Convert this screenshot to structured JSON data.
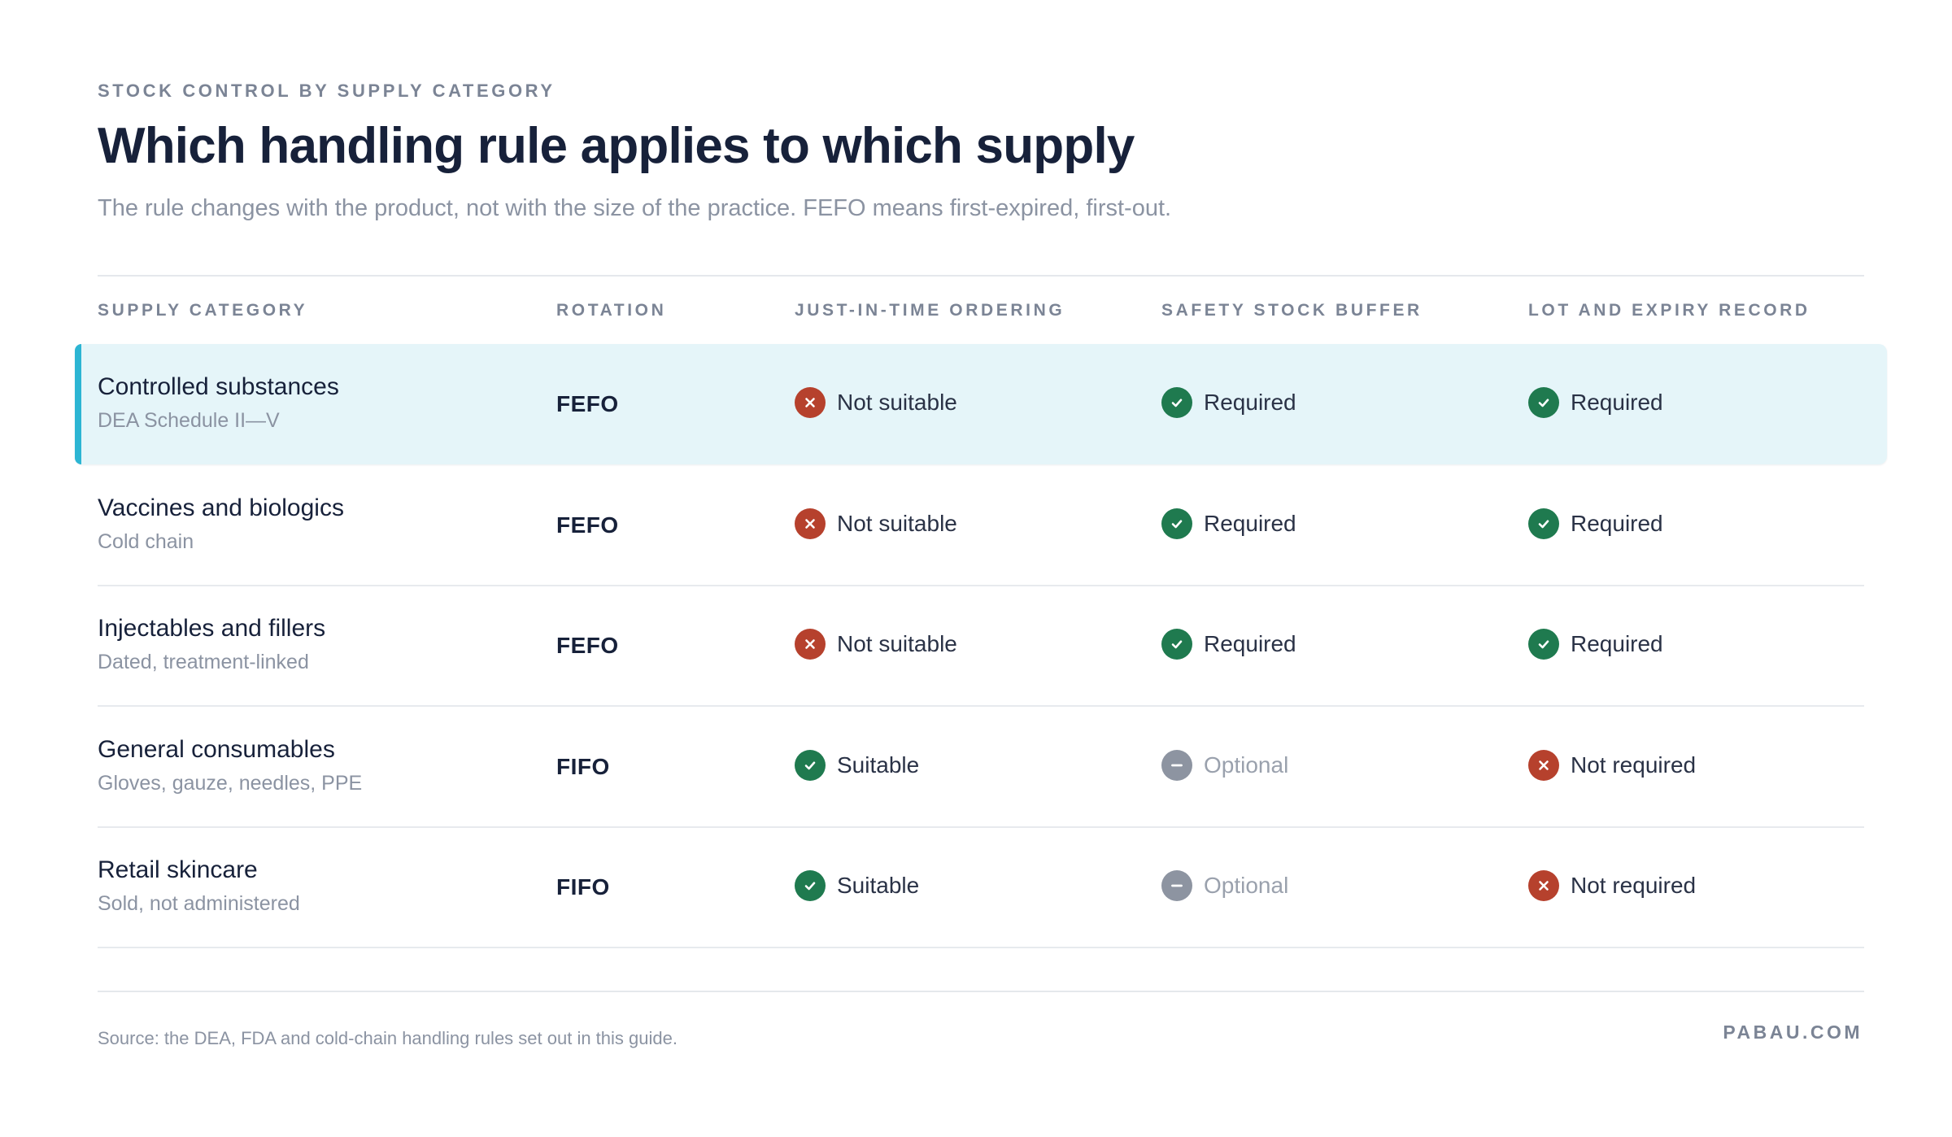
{
  "header": {
    "eyebrow": "STOCK CONTROL BY SUPPLY CATEGORY",
    "title": "Which handling rule applies to which supply",
    "subtitle": "The rule changes with the product, not with the size of the practice. FEFO means first-expired, first-out."
  },
  "table": {
    "columns": [
      "SUPPLY CATEGORY",
      "ROTATION",
      "JUST-IN-TIME ORDERING",
      "SAFETY STOCK BUFFER",
      "LOT AND EXPIRY RECORD"
    ],
    "highlighted_row": 0,
    "rows": [
      {
        "name": "Controlled substances",
        "detail": "DEA Schedule II—V",
        "rotation": "FEFO",
        "jit": {
          "status": "no",
          "label": "Not suitable"
        },
        "safety": {
          "status": "ok",
          "label": "Required"
        },
        "lot": {
          "status": "ok",
          "label": "Required"
        }
      },
      {
        "name": "Vaccines and biologics",
        "detail": "Cold chain",
        "rotation": "FEFO",
        "jit": {
          "status": "no",
          "label": "Not suitable"
        },
        "safety": {
          "status": "ok",
          "label": "Required"
        },
        "lot": {
          "status": "ok",
          "label": "Required"
        }
      },
      {
        "name": "Injectables and fillers",
        "detail": "Dated, treatment-linked",
        "rotation": "FEFO",
        "jit": {
          "status": "no",
          "label": "Not suitable"
        },
        "safety": {
          "status": "ok",
          "label": "Required"
        },
        "lot": {
          "status": "ok",
          "label": "Required"
        }
      },
      {
        "name": "General consumables",
        "detail": "Gloves, gauze, needles, PPE",
        "rotation": "FIFO",
        "jit": {
          "status": "ok",
          "label": "Suitable"
        },
        "safety": {
          "status": "opt",
          "label": "Optional"
        },
        "lot": {
          "status": "no",
          "label": "Not required"
        }
      },
      {
        "name": "Retail skincare",
        "detail": "Sold, not administered",
        "rotation": "FIFO",
        "jit": {
          "status": "ok",
          "label": "Suitable"
        },
        "safety": {
          "status": "opt",
          "label": "Optional"
        },
        "lot": {
          "status": "no",
          "label": "Not required"
        }
      }
    ]
  },
  "footer": {
    "source": "Source: the DEA, FDA and cold-chain handling rules set out in this guide.",
    "brand": "PABAU.COM"
  },
  "colors": {
    "ok": "#1f7a4f",
    "no": "#b6412d",
    "optional": "#8d94a1",
    "highlight": "#e5f5f9",
    "accent": "#2cb5d3"
  }
}
